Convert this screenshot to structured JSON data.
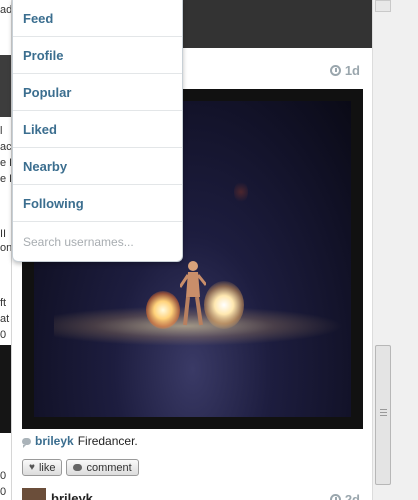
{
  "left_strip": {
    "fragments": [
      "ad",
      "l",
      "ac",
      "e L",
      "e D",
      "II",
      "on",
      "ft",
      "at",
      "0",
      "0",
      "0"
    ]
  },
  "post": {
    "time": "1d",
    "caption_user": "brileyk",
    "caption_text": "Firedancer.",
    "like_label": "like",
    "comment_label": "comment"
  },
  "next_post": {
    "username": "brileyk",
    "time": "2d"
  },
  "menu": {
    "items": [
      "Feed",
      "Profile",
      "Popular",
      "Liked",
      "Nearby",
      "Following"
    ],
    "search_placeholder": "Search usernames..."
  },
  "colors": {
    "link": "#3b6e8f",
    "topbar": "#333333",
    "timestamp": "#9aa6ad"
  }
}
